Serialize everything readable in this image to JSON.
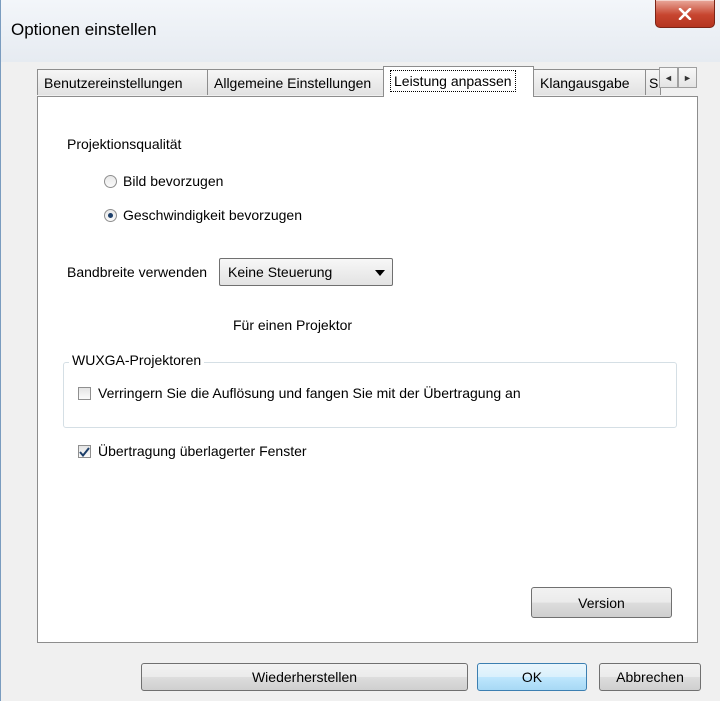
{
  "window": {
    "title": "Optionen einstellen",
    "close_label": "X"
  },
  "tabs": [
    {
      "label": "Benutzereinstellungen",
      "active": false
    },
    {
      "label": "Allgemeine Einstellungen",
      "active": false
    },
    {
      "label": "Leistung anpassen",
      "active": true
    },
    {
      "label": "Klangausgabe",
      "active": false
    },
    {
      "label": "S",
      "active": false
    }
  ],
  "tab_scroll": {
    "left": "◄",
    "right": "►"
  },
  "performance": {
    "projection_quality_label": "Projektionsqualität",
    "options": [
      {
        "label": "Bild bevorzugen",
        "selected": false
      },
      {
        "label": "Geschwindigkeit bevorzugen",
        "selected": true
      }
    ],
    "bandwidth_label": "Bandbreite verwenden",
    "bandwidth_value": "Keine Steuerung",
    "projector_note": "Für einen Projektor",
    "wuxga_group_label": "WUXGA-Projektoren",
    "wuxga_checkbox": {
      "label": "Verringern Sie die Auflösung und fangen Sie mit der Übertragung an",
      "checked": false
    },
    "overlay_checkbox": {
      "label": "Übertragung überlagerter Fenster",
      "checked": true
    },
    "version_button": "Version"
  },
  "footer": {
    "restore_button": "Wiederherstellen",
    "ok_button": "OK",
    "cancel_button": "Abbrechen"
  }
}
